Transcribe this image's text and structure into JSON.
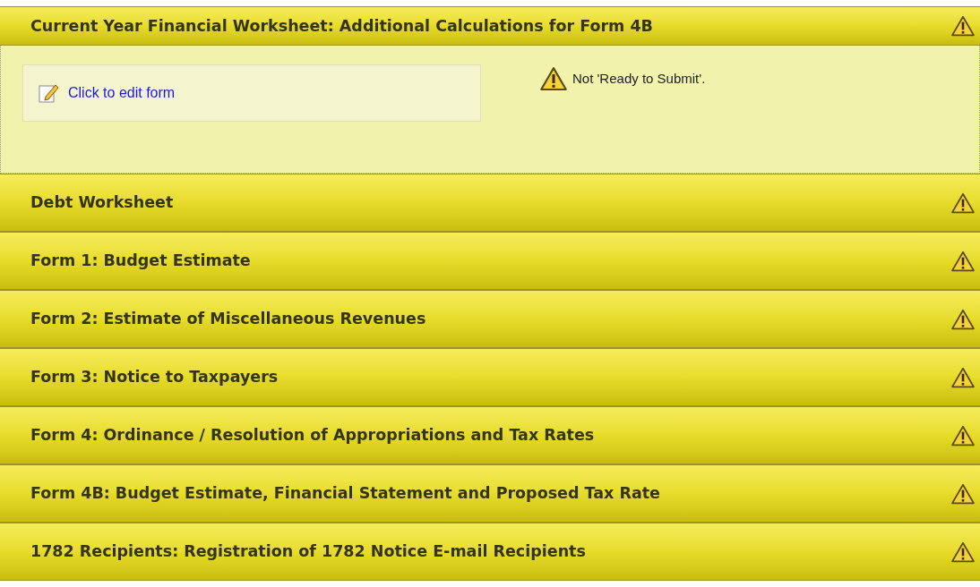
{
  "sections": [
    {
      "title": "Current Year Financial Worksheet: Additional Calculations for Form 4B",
      "expanded": true,
      "edit_link": "Click to edit form",
      "status": "Not 'Ready to Submit'."
    },
    {
      "title": "Debt Worksheet",
      "expanded": false
    },
    {
      "title": "Form 1: Budget Estimate",
      "expanded": false
    },
    {
      "title": "Form 2: Estimate of Miscellaneous Revenues",
      "expanded": false
    },
    {
      "title": "Form 3: Notice to Taxpayers",
      "expanded": false
    },
    {
      "title": "Form 4: Ordinance / Resolution of Appropriations and Tax Rates",
      "expanded": false
    },
    {
      "title": "Form 4B: Budget Estimate, Financial Statement and Proposed Tax Rate",
      "expanded": false
    },
    {
      "title": "1782 Recipients: Registration of 1782 Notice E-mail Recipients",
      "expanded": false
    }
  ]
}
